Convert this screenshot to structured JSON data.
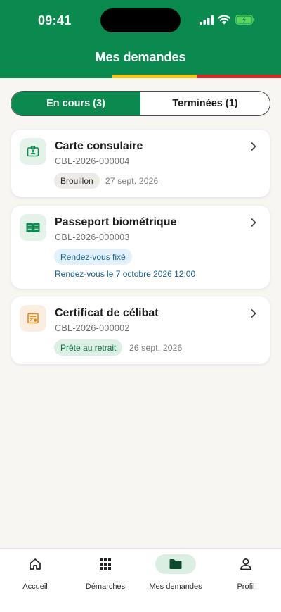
{
  "status_bar": {
    "time": "09:41"
  },
  "header": {
    "title": "Mes demandes"
  },
  "tabs": [
    {
      "label": "En cours (3)",
      "active": true
    },
    {
      "label": "Terminées (1)",
      "active": false
    }
  ],
  "requests": [
    {
      "title": "Carte consulaire",
      "reference": "CBL-2026-000004",
      "status": "Brouillon",
      "date": "27 sept. 2026",
      "icon": "id-card-icon"
    },
    {
      "title": "Passeport biométrique",
      "reference": "CBL-2026-000003",
      "status": "Rendez-vous fixé",
      "appointment": "Rendez-vous le 7 octobre 2026 12:00",
      "icon": "passport-book-icon"
    },
    {
      "title": "Certificat de célibat",
      "reference": "CBL-2026-000002",
      "status": "Prête au retrait",
      "date": "26 sept. 2026",
      "icon": "certificate-icon"
    }
  ],
  "bottom_nav": [
    {
      "label": "Accueil",
      "icon": "home-icon"
    },
    {
      "label": "Démarches",
      "icon": "grid-icon"
    },
    {
      "label": "Mes demandes",
      "icon": "folder-icon",
      "active": true
    },
    {
      "label": "Profil",
      "icon": "user-icon"
    }
  ],
  "colors": {
    "primary": "#0a8a4e",
    "flag_yellow": "#f5c518",
    "flag_red": "#d42a2a",
    "badge_draft": "#ecebe8",
    "badge_appointment": "#e3f1fc",
    "badge_ready": "#dcefe4",
    "appointment_text": "#14628f"
  }
}
